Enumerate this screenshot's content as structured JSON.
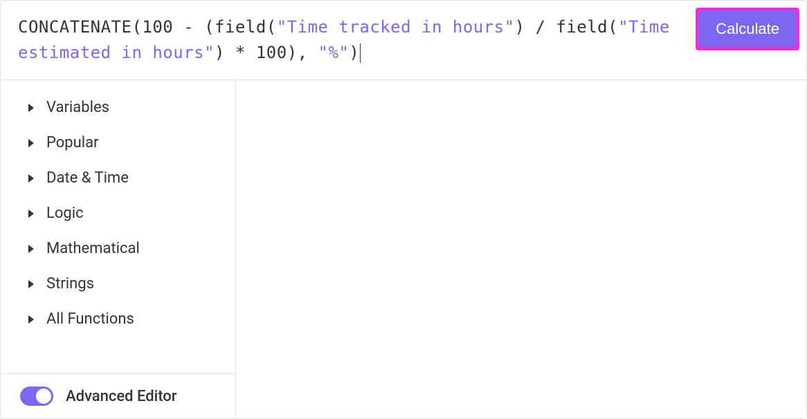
{
  "formula": {
    "parts": [
      {
        "type": "plain",
        "text": "CONCATENATE(100 - (field("
      },
      {
        "type": "string",
        "text": "\"Time tracked in hours\""
      },
      {
        "type": "plain",
        "text": ") / field("
      },
      {
        "type": "string",
        "text": "\"Time estimated in hours\""
      },
      {
        "type": "plain",
        "text": ") * 100), "
      },
      {
        "type": "string",
        "text": "\"%\""
      },
      {
        "type": "plain",
        "text": ")"
      }
    ]
  },
  "calculate_label": "Calculate",
  "sidebar": {
    "categories": [
      {
        "label": "Variables"
      },
      {
        "label": "Popular"
      },
      {
        "label": "Date & Time"
      },
      {
        "label": "Logic"
      },
      {
        "label": "Mathematical"
      },
      {
        "label": "Strings"
      },
      {
        "label": "All Functions"
      }
    ],
    "advanced_editor_label": "Advanced Editor",
    "advanced_editor_on": true
  }
}
